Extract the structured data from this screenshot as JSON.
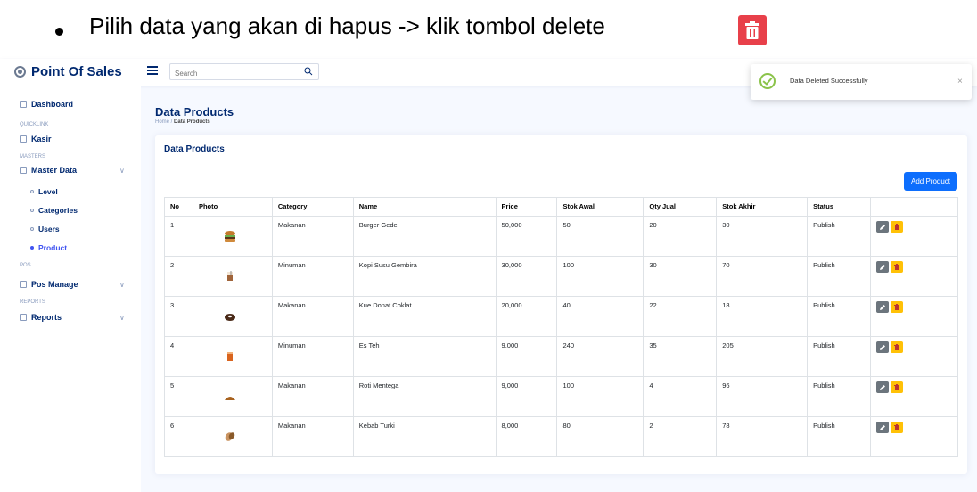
{
  "caption": {
    "text": "Pilih data yang akan di hapus -> klik tombol delete",
    "badge_color": "#e8404a",
    "icon": "trash-icon"
  },
  "app": {
    "brand": "Point Of Sales",
    "search_placeholder": "Search"
  },
  "sidebar": {
    "dashboard": "Dashboard",
    "quicklink": "QUICKLINK",
    "kasir": "Kasir",
    "masters": "MASTERS",
    "master_data": "Master Data",
    "subs": [
      "Level",
      "Categories",
      "Users",
      "Product"
    ],
    "pos": "POS",
    "pos_manage": "Pos Manage",
    "reports_head": "REPORTS",
    "reports": "Reports"
  },
  "page": {
    "title": "Data Products",
    "crumb_home": "Home",
    "crumb_sep": " / ",
    "crumb_current": "Data Products"
  },
  "card": {
    "title": "Data Products",
    "add_button": "Add Product"
  },
  "table": {
    "headers": [
      "No",
      "Photo",
      "Category",
      "Name",
      "Price",
      "Stok Awal",
      "Qty Jual",
      "Stok Akhir",
      "Status",
      ""
    ],
    "rows": [
      {
        "no": "1",
        "category": "Makanan",
        "name": "Burger Gede",
        "price": "50,000",
        "stok_awal": "50",
        "qty_jual": "20",
        "stok_akhir": "30",
        "status": "Publish",
        "photo": "burger-icon"
      },
      {
        "no": "2",
        "category": "Minuman",
        "name": "Kopi Susu Gembira",
        "price": "30,000",
        "stok_awal": "100",
        "qty_jual": "30",
        "stok_akhir": "70",
        "status": "Publish",
        "photo": "coffee-icon"
      },
      {
        "no": "3",
        "category": "Makanan",
        "name": "Kue Donat Coklat",
        "price": "20,000",
        "stok_awal": "40",
        "qty_jual": "22",
        "stok_akhir": "18",
        "status": "Publish",
        "photo": "donut-icon"
      },
      {
        "no": "4",
        "category": "Minuman",
        "name": "Es Teh",
        "price": "9,000",
        "stok_awal": "240",
        "qty_jual": "35",
        "stok_akhir": "205",
        "status": "Publish",
        "photo": "iced-tea-icon"
      },
      {
        "no": "5",
        "category": "Makanan",
        "name": "Roti Mentega",
        "price": "9,000",
        "stok_awal": "100",
        "qty_jual": "4",
        "stok_akhir": "96",
        "status": "Publish",
        "photo": "bread-icon"
      },
      {
        "no": "6",
        "category": "Makanan",
        "name": "Kebab Turki",
        "price": "8,000",
        "stok_awal": "80",
        "qty_jual": "2",
        "stok_akhir": "78",
        "status": "Publish",
        "photo": "kebab-icon"
      }
    ]
  },
  "toast": {
    "message": "Data Deleted Successfully",
    "close": "×"
  },
  "colors": {
    "primary": "#0d6efd",
    "edit": "#6c757d",
    "delete": "#ffc107",
    "success": "#8bc34a"
  }
}
